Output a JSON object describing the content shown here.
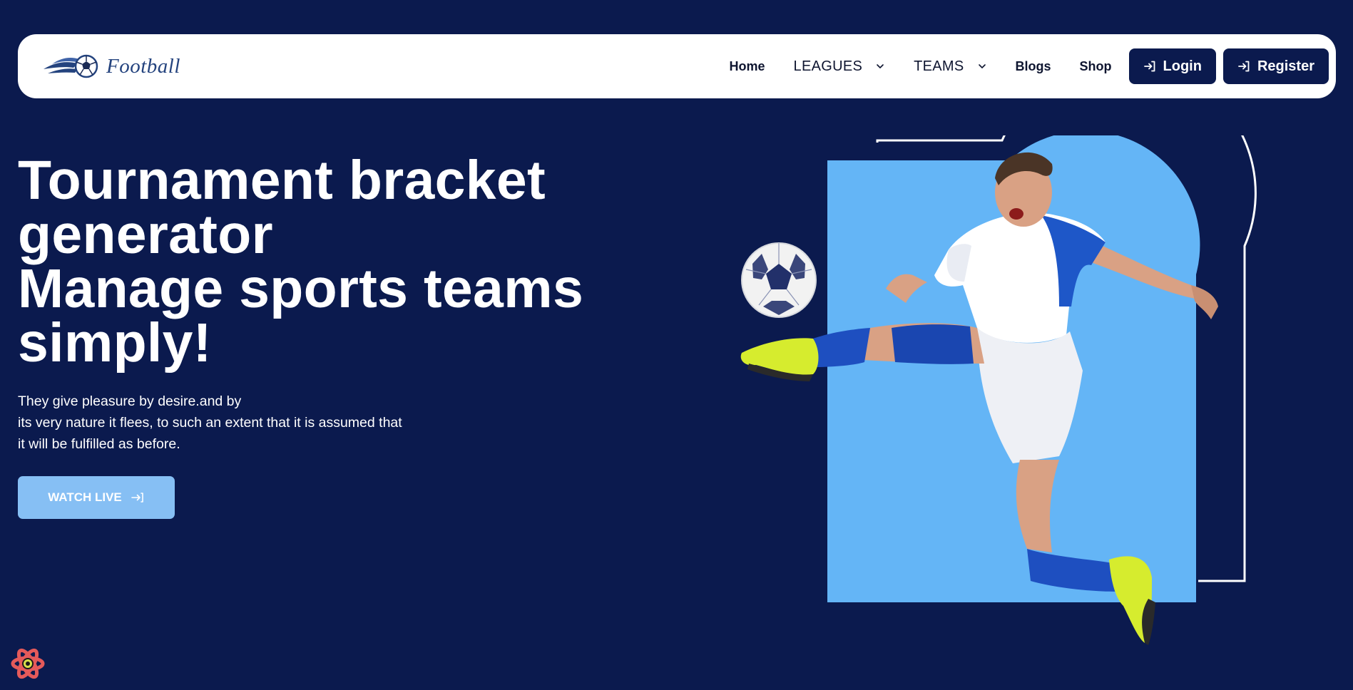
{
  "brand": {
    "name": "Football"
  },
  "nav": {
    "links": [
      {
        "label": "Home"
      },
      {
        "label": "LEAGUES"
      },
      {
        "label": "TEAMS"
      },
      {
        "label": "Blogs"
      },
      {
        "label": "Shop"
      }
    ],
    "login_label": "Login",
    "register_label": "Register"
  },
  "hero": {
    "title_line1": "Tournament bracket",
    "title_line2": "generator",
    "title_line3": "Manage sports teams",
    "title_line4": "simply!",
    "desc_line1": "They give pleasure by desire.and by",
    "desc_line2": "its very nature it flees, to such an extent that it is assumed that",
    "desc_line3": "it will be fulfilled as before.",
    "cta_label": "WATCH LIVE"
  },
  "icons": {
    "login": "login-arrow-icon",
    "register": "login-arrow-icon",
    "cta": "arrow-right-bracket-icon",
    "dropdown": "chevron-down-icon",
    "corner": "react-logo-icon"
  },
  "colors": {
    "background": "#0b1a4e",
    "navbar": "#ffffff",
    "button": "#0b1a4e",
    "cta": "#86bff4",
    "panel": "#64b5f6",
    "logo": "#24437e"
  }
}
